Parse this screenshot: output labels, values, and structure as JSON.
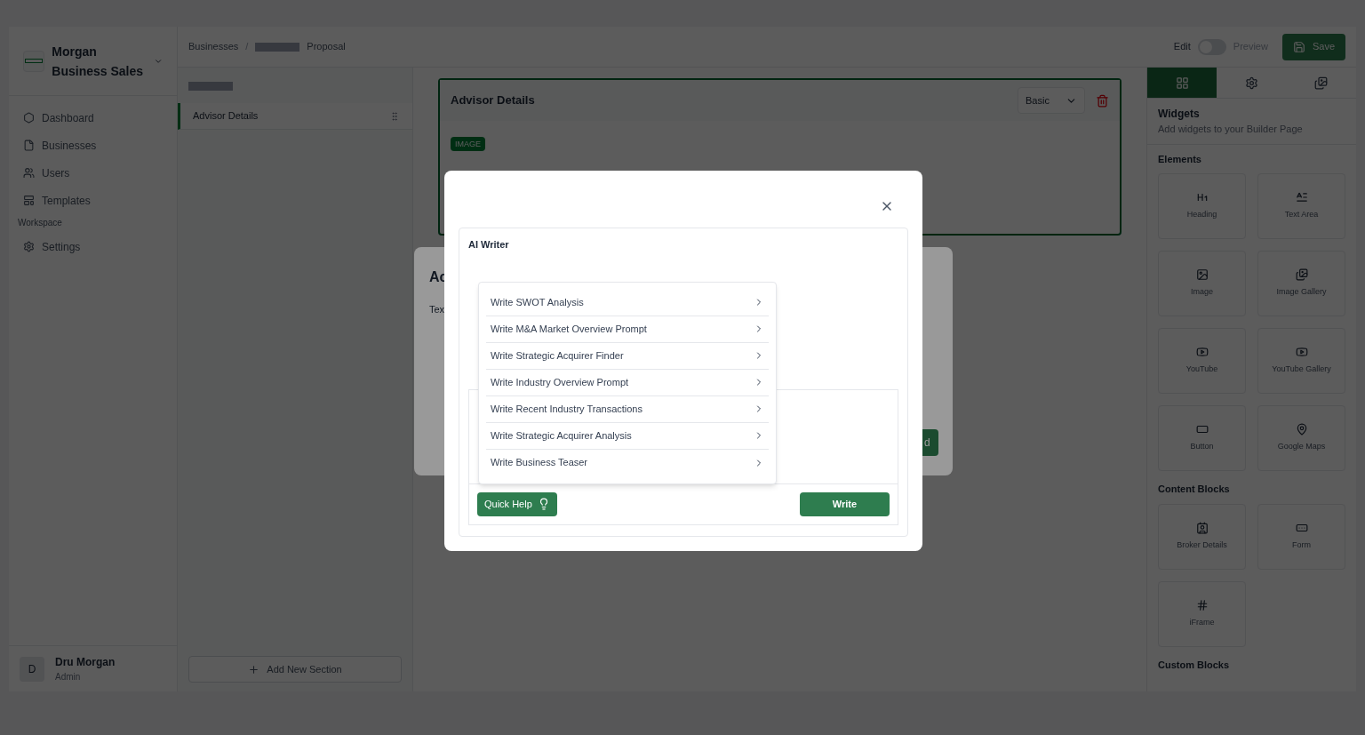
{
  "sidebar": {
    "brand": "Morgan Business Sales",
    "nav": [
      {
        "label": "Dashboard",
        "kind": "dashboard",
        "selected": false
      },
      {
        "label": "Businesses",
        "kind": "businesses",
        "selected": false
      },
      {
        "label": "Users",
        "kind": "users",
        "selected": false
      },
      {
        "label": "Templates",
        "kind": "templates",
        "selected": false
      }
    ],
    "workspace_label": "Workspace",
    "workspace_items": [
      {
        "label": "Settings",
        "kind": "settings",
        "selected": false
      }
    ],
    "user": {
      "initial": "D",
      "name": "Dru Morgan",
      "role": "Admin"
    }
  },
  "header": {
    "breadcrumb": [
      {
        "label": "Businesses",
        "kind": "text"
      },
      {
        "label": "/",
        "kind": "separator"
      },
      {
        "kind": "redacted"
      },
      {
        "label": "Proposal",
        "kind": "text"
      }
    ],
    "mode": {
      "edit_label": "Edit",
      "preview_label": "Preview",
      "on": false
    },
    "save_label": "Save"
  },
  "sections": {
    "items": [
      {
        "label": "Advisor Details",
        "selected": true
      }
    ],
    "add_label": "Add New Section"
  },
  "canvas": {
    "title": "Advisor Details",
    "style_select": "Basic",
    "tag": "IMAGE"
  },
  "right_panel": {
    "tabs": [
      {
        "kind": "widgets",
        "selected": true
      },
      {
        "kind": "settings",
        "selected": false
      },
      {
        "kind": "gallery",
        "selected": false
      }
    ],
    "title": "Widgets",
    "subtitle": "Add widgets to your Builder Page",
    "groups": [
      {
        "title": "Elements",
        "items": [
          {
            "label": "Heading",
            "kind": "heading"
          },
          {
            "label": "Text Area",
            "kind": "text"
          },
          {
            "label": "Image",
            "kind": "image"
          },
          {
            "label": "Image Gallery",
            "kind": "gallery"
          },
          {
            "label": "YouTube",
            "kind": "youtube"
          },
          {
            "label": "YouTube Gallery",
            "kind": "youtube"
          },
          {
            "label": "Button",
            "kind": "button"
          },
          {
            "label": "Google Maps",
            "kind": "map"
          }
        ]
      },
      {
        "title": "Content Blocks",
        "items": [
          {
            "label": "Broker Details",
            "kind": "contact"
          },
          {
            "label": "Form",
            "kind": "form"
          },
          {
            "label": "iFrame",
            "kind": "frame"
          }
        ]
      },
      {
        "title": "Custom Blocks"
      }
    ]
  },
  "back_dialog": {
    "title": "Ac",
    "field_label": "Tex",
    "button": "d"
  },
  "ai_writer": {
    "title": "AI Writer",
    "menu": [
      "Write SWOT Analysis",
      "Write M&A Market Overview Prompt",
      "Write Strategic Acquirer Finder",
      "Write Industry Overview Prompt",
      "Write Recent Industry Transactions",
      "Write Strategic Acquirer Analysis",
      "Write Business Teaser"
    ],
    "quick_help": "Quick Help",
    "write": "Write"
  }
}
